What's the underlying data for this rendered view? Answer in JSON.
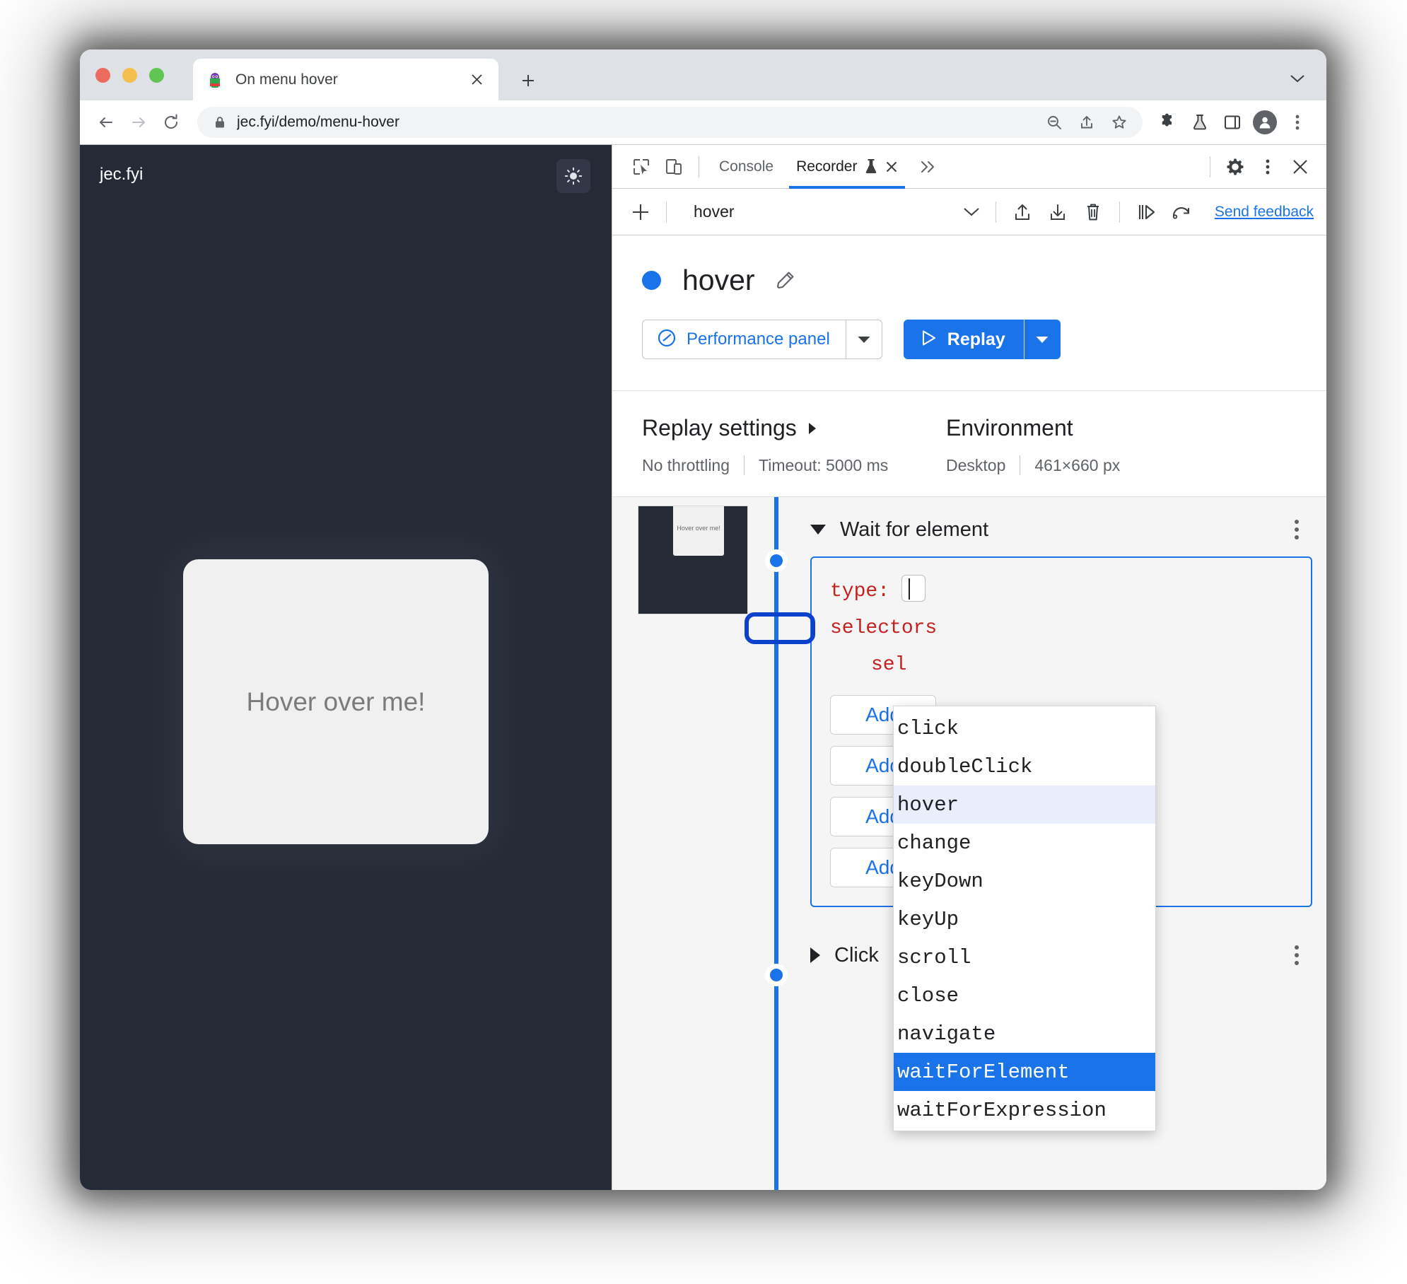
{
  "browser": {
    "tab": {
      "title": "On menu hover",
      "favicon_icon": "monster-favicon",
      "close_icon": "close-icon"
    },
    "new_tab_icon": "plus-icon",
    "tabstrip_chevron_icon": "chevron-down-icon",
    "nav": {
      "back_icon": "back-arrow-icon",
      "forward_icon": "forward-arrow-icon",
      "reload_icon": "reload-icon"
    },
    "omnibox": {
      "lock_icon": "lock-icon",
      "url": "jec.fyi/demo/menu-hover",
      "zoom_icon": "zoom-out-icon",
      "share_icon": "share-icon",
      "bookmark_icon": "star-icon"
    },
    "extensions_icon": "puzzle-icon",
    "labs_icon": "flask-icon",
    "sidepanel_icon": "side-panel-icon",
    "profile_icon": "avatar-icon",
    "menu_icon": "three-dot-menu-icon"
  },
  "page": {
    "brand": "jec.fyi",
    "theme_toggle_icon": "sun-icon",
    "card_label": "Hover over me!",
    "bg_color": "#252a37",
    "card_color": "#f0f0f0"
  },
  "devtools": {
    "inspect_icon": "inspect-cursor-icon",
    "device_toolbar_icon": "device-toggle-icon",
    "tabs": [
      {
        "label": "Console",
        "active": false
      },
      {
        "label": "Recorder",
        "active": true,
        "flask_icon": "flask-icon",
        "close_icon": "close-icon"
      }
    ],
    "more_tabs_icon": "double-chevron-right-icon",
    "settings_icon": "gear-icon",
    "more_icon": "three-dot-menu-icon",
    "close_icon": "close-icon",
    "accent_color": "#1a73e8"
  },
  "recorder": {
    "toolbar": {
      "add_icon": "plus-icon",
      "recording_name": "hover",
      "name_chevron_icon": "chevron-down-icon",
      "import_icon": "upload-icon",
      "export_icon": "download-icon",
      "delete_icon": "trash-icon",
      "step_by_step_icon": "step-replay-icon",
      "slow_replay_icon": "slow-replay-icon",
      "feedback_label": "Send feedback"
    },
    "header": {
      "status_dot_color": "#1a73e8",
      "title": "hover",
      "edit_icon": "pencil-icon"
    },
    "buttons": {
      "performance_icon": "performance-gauge-icon",
      "performance_label": "Performance panel",
      "performance_caret_icon": "caret-down-icon",
      "replay_play_icon": "play-icon",
      "replay_label": "Replay",
      "replay_caret_icon": "caret-down-icon"
    },
    "settings": {
      "replay_heading": "Replay settings",
      "replay_heading_caret_icon": "caret-right-icon",
      "throttling": "No throttling",
      "timeout": "Timeout: 5000 ms",
      "environment_heading": "Environment",
      "device": "Desktop",
      "viewport": "461×660 px"
    },
    "steps": [
      {
        "label": "Wait for element",
        "expanded": true,
        "caret_icon": "caret-down-icon",
        "menu_icon": "three-dot-menu-icon",
        "thumbnail_label": "Hover over me!",
        "code": {
          "type_key": "type:",
          "type_value": "",
          "selectors_key": "selectors",
          "selector_key": "sel"
        },
        "add_buttons": [
          "Add",
          "Add",
          "Add",
          "Add"
        ]
      },
      {
        "label": "Click",
        "expanded": false,
        "caret_icon": "caret-right-icon",
        "menu_icon": "three-dot-menu-icon"
      }
    ],
    "autocomplete": {
      "items": [
        {
          "label": "click",
          "state": "normal"
        },
        {
          "label": "doubleClick",
          "state": "normal"
        },
        {
          "label": "hover",
          "state": "hovered"
        },
        {
          "label": "change",
          "state": "normal"
        },
        {
          "label": "keyDown",
          "state": "normal"
        },
        {
          "label": "keyUp",
          "state": "normal"
        },
        {
          "label": "scroll",
          "state": "normal"
        },
        {
          "label": "close",
          "state": "normal"
        },
        {
          "label": "navigate",
          "state": "normal"
        },
        {
          "label": "waitForElement",
          "state": "selected"
        },
        {
          "label": "waitForExpression",
          "state": "normal"
        }
      ],
      "annotation_target": "hover",
      "annotation_color": "#0b41cd"
    }
  }
}
